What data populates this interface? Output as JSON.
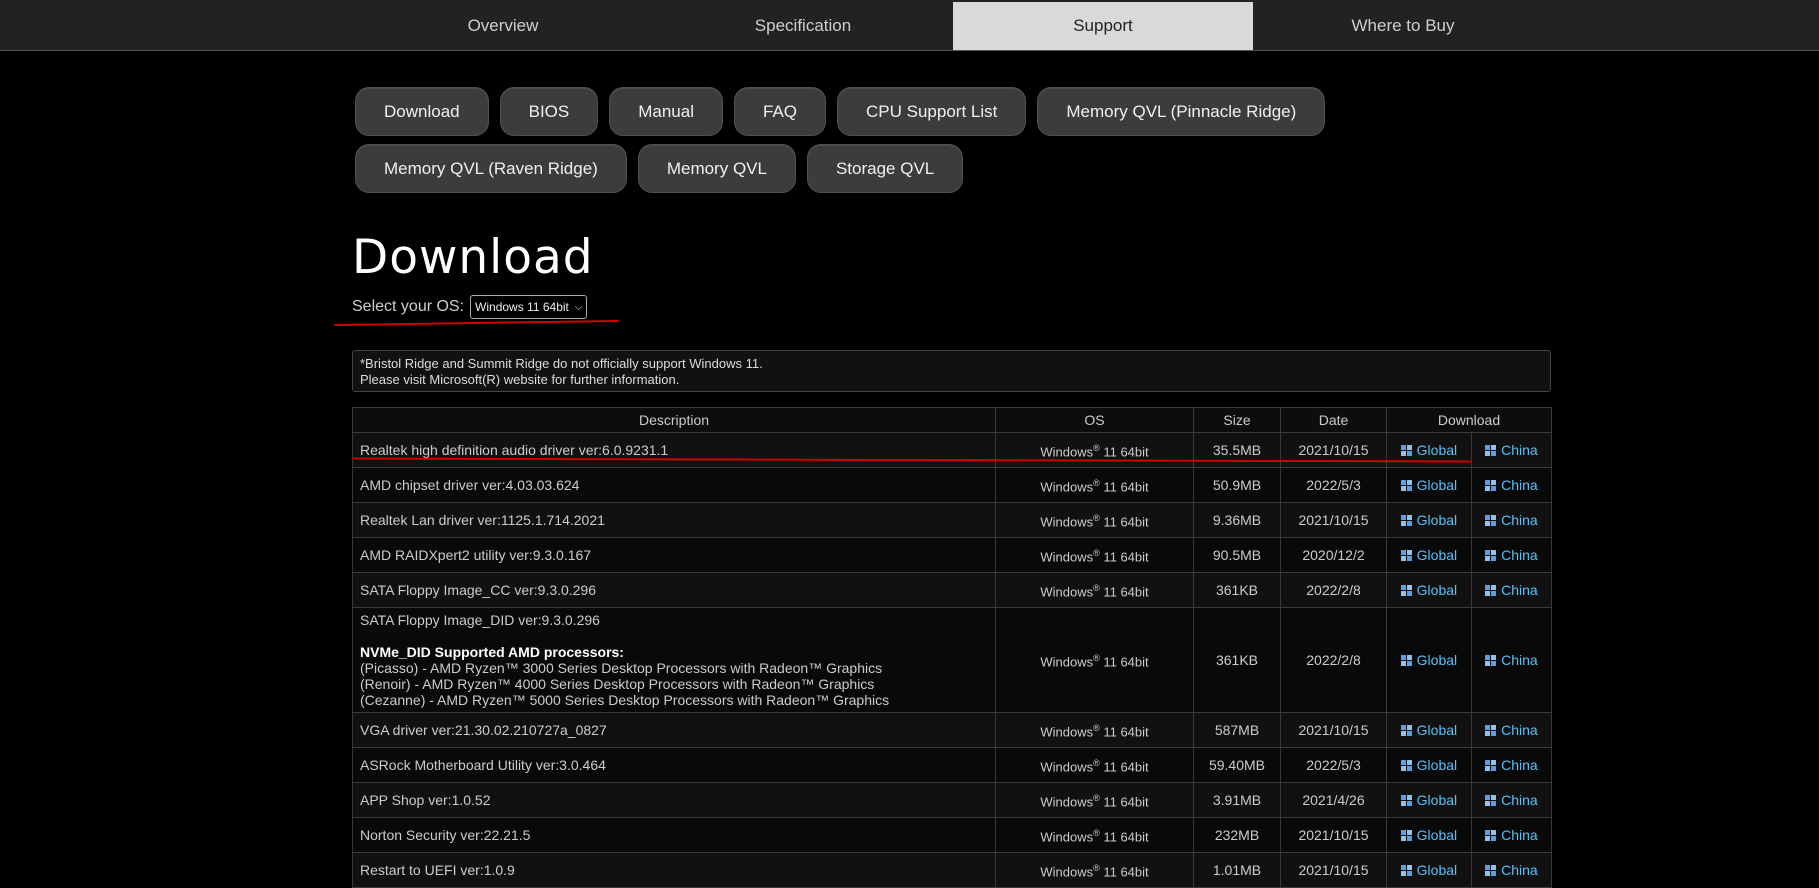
{
  "top_nav": [
    {
      "label": "Overview",
      "active": false
    },
    {
      "label": "Specification",
      "active": false
    },
    {
      "label": "Support",
      "active": true
    },
    {
      "label": "Where to Buy",
      "active": false
    }
  ],
  "support_nav": {
    "row1": [
      "Download",
      "BIOS",
      "Manual",
      "FAQ",
      "CPU Support List",
      "Memory QVL (Pinnacle Ridge)"
    ],
    "row2": [
      "Memory QVL (Raven Ridge)",
      "Memory QVL",
      "Storage QVL"
    ]
  },
  "page_title": "Download",
  "os_select": {
    "label": "Select your OS:",
    "value": "Windows 11 64bit"
  },
  "notice": {
    "line1": "*Bristol Ridge and Summit Ridge do not officially support Windows 11.",
    "line2": "Please visit Microsoft(R) website for further information."
  },
  "table": {
    "headers": {
      "description": "Description",
      "os": "OS",
      "size": "Size",
      "date": "Date",
      "download": "Download"
    },
    "os_prefix": "Windows",
    "os_mark": "®",
    "os_suffix": " 11 64bit",
    "link_global": "Global",
    "link_china": "China",
    "rows": [
      {
        "description": "Realtek high definition audio driver ver:6.0.9231.1",
        "size": "35.5MB",
        "date": "2021/10/15"
      },
      {
        "description": "AMD chipset driver ver:4.03.03.624",
        "size": "50.9MB",
        "date": "2022/5/3"
      },
      {
        "description": "Realtek Lan driver ver:1125.1.714.2021",
        "size": "9.36MB",
        "date": "2021/10/15"
      },
      {
        "description": "AMD RAIDXpert2 utility ver:9.3.0.167",
        "size": "90.5MB",
        "date": "2020/12/2"
      },
      {
        "description": "SATA Floppy Image_CC ver:9.3.0.296",
        "size": "361KB",
        "date": "2022/2/8"
      },
      {
        "description": "SATA Floppy Image_DID ver:9.3.0.296",
        "size": "361KB",
        "date": "2022/2/8",
        "detail_title": "NVMe_DID Supported AMD processors:",
        "detail_lines": [
          "(Picasso) - AMD Ryzen™ 3000 Series Desktop Processors with Radeon™ Graphics",
          "(Renoir) - AMD Ryzen™ 4000 Series Desktop Processors with Radeon™ Graphics",
          "(Cezanne) - AMD Ryzen™ 5000 Series Desktop Processors with Radeon™ Graphics"
        ]
      },
      {
        "description": "VGA driver ver:21.30.02.210727a_0827",
        "size": "587MB",
        "date": "2021/10/15"
      },
      {
        "description": "ASRock Motherboard Utility ver:3.0.464",
        "size": "59.40MB",
        "date": "2022/5/3"
      },
      {
        "description": "APP Shop ver:1.0.52",
        "size": "3.91MB",
        "date": "2021/4/26"
      },
      {
        "description": "Norton Security ver:22.21.5",
        "size": "232MB",
        "date": "2021/10/15"
      },
      {
        "description": "Restart to UEFI ver:1.0.9",
        "size": "1.01MB",
        "date": "2021/10/15"
      }
    ]
  },
  "annotation_color": "#d00000"
}
